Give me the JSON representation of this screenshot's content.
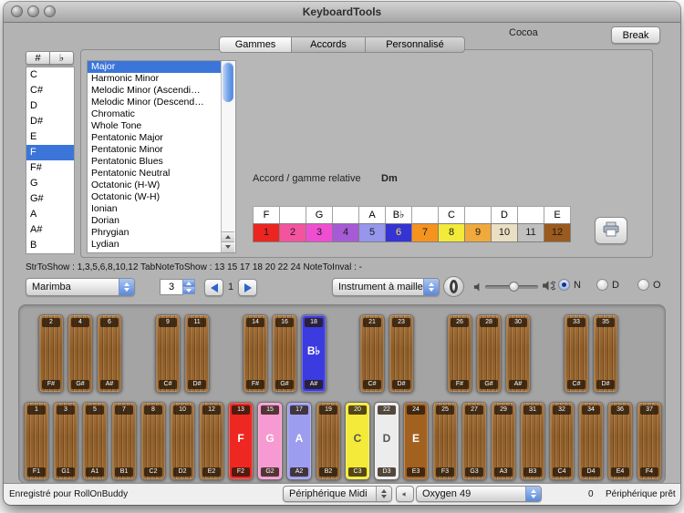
{
  "window": {
    "title": "KeyboardTools"
  },
  "header": {
    "cocoa": "Cocoa",
    "break": "Break"
  },
  "tabs": [
    {
      "label": "Gammes",
      "active": true
    },
    {
      "label": "Accords",
      "active": false
    },
    {
      "label": "Personnalisé",
      "active": false
    }
  ],
  "note_selector": {
    "sharp": "#",
    "flat": "♭",
    "notes": [
      "C",
      "C#",
      "D",
      "D#",
      "E",
      "F",
      "F#",
      "G",
      "G#",
      "A",
      "A#",
      "B"
    ],
    "selected_index": 5
  },
  "scales": {
    "items": [
      "Major",
      "Harmonic Minor",
      "Melodic Minor (Ascendi…",
      "Melodic Minor (Descend…",
      "Chromatic",
      "Whole Tone",
      "Pentatonic Major",
      "Pentatonic Minor",
      "Pentatonic Blues",
      "Pentatonic Neutral",
      "Octatonic (H-W)",
      "Octatonic (W-H)",
      "Ionian",
      "Dorian",
      "Phrygian",
      "Lydian"
    ],
    "selected_index": 0
  },
  "relative": {
    "label": "Accord / gamme relative",
    "value": "Dm"
  },
  "scale_cells": {
    "letters": [
      "F",
      "",
      "G",
      "",
      "A",
      "B♭",
      "",
      "C",
      "",
      "D",
      "",
      "E"
    ],
    "cells": [
      {
        "num": "1",
        "color": "#ec2520",
        "text": "#1a1a1a"
      },
      {
        "num": "2",
        "color": "#f4549e",
        "text": "#1a1a1a"
      },
      {
        "num": "3",
        "color": "#f04ed2",
        "text": "#1a1a1a"
      },
      {
        "num": "4",
        "color": "#a75ad6",
        "text": "#1a1a1a"
      },
      {
        "num": "5",
        "color": "#9696ec",
        "text": "#1a1a1a"
      },
      {
        "num": "6",
        "color": "#3434d4",
        "text": "#ffe04a"
      },
      {
        "num": "7",
        "color": "#f5931f",
        "text": "#1a1a1a"
      },
      {
        "num": "8",
        "color": "#f3ea39",
        "text": "#1a1a1a"
      },
      {
        "num": "9",
        "color": "#efa93c",
        "text": "#1a1a1a"
      },
      {
        "num": "10",
        "color": "#eadfc4",
        "text": "#1a1a1a"
      },
      {
        "num": "11",
        "color": "#c0c0c0",
        "text": "#1a1a1a"
      },
      {
        "num": "12",
        "color": "#9b5a1e",
        "text": "#1a1a1a"
      }
    ]
  },
  "status_line": "StrToShow : 1,3,5,6,8,10,12 TabNoteToShow : 13 15 17 18 20 22 24  NoteToInval : -",
  "controls": {
    "instrument_popup": "Marimba",
    "octave_value": "3",
    "page_value": "1",
    "mallet_popup": "Instrument à maillet",
    "radios": [
      {
        "label": "N",
        "selected": true
      },
      {
        "label": "D",
        "selected": false
      },
      {
        "label": "O",
        "selected": false
      }
    ]
  },
  "keyboard": {
    "top_bars": [
      {
        "num": "2",
        "note": "F#"
      },
      {
        "num": "4",
        "note": "G#"
      },
      {
        "num": "6",
        "note": "A#"
      },
      {
        "num": "9",
        "note": "C#"
      },
      {
        "num": "11",
        "note": "D#"
      },
      {
        "num": "14",
        "note": "F#"
      },
      {
        "num": "16",
        "note": "G#"
      },
      {
        "num": "18",
        "note": "A#",
        "display": "B♭",
        "color": "#3b3be0",
        "text_color": "#ffffff"
      },
      {
        "num": "21",
        "note": "C#"
      },
      {
        "num": "23",
        "note": "D#"
      },
      {
        "num": "26",
        "note": "F#"
      },
      {
        "num": "28",
        "note": "G#"
      },
      {
        "num": "30",
        "note": "A#"
      },
      {
        "num": "33",
        "note": "C#"
      },
      {
        "num": "35",
        "note": "D#"
      }
    ],
    "bottom_bars": [
      {
        "num": "1",
        "note": "F1"
      },
      {
        "num": "3",
        "note": "G1"
      },
      {
        "num": "5",
        "note": "A1"
      },
      {
        "num": "7",
        "note": "B1"
      },
      {
        "num": "8",
        "note": "C2"
      },
      {
        "num": "10",
        "note": "D2"
      },
      {
        "num": "12",
        "note": "E2"
      },
      {
        "num": "13",
        "note": "F2",
        "display": "F",
        "color": "#ee2722",
        "text_color": "#ffffff"
      },
      {
        "num": "15",
        "note": "G2",
        "display": "G",
        "color": "#f79ad2",
        "text_color": "#ffffff"
      },
      {
        "num": "17",
        "note": "A2",
        "display": "A",
        "color": "#9d9df0",
        "text_color": "#ffffff"
      },
      {
        "num": "19",
        "note": "B2"
      },
      {
        "num": "20",
        "note": "C3",
        "display": "C",
        "color": "#f3ea39",
        "text_color": "#555555"
      },
      {
        "num": "22",
        "note": "D3",
        "display": "D",
        "color": "#ececec",
        "text_color": "#555555"
      },
      {
        "num": "24",
        "note": "E3",
        "display": "E",
        "color": "#a3611f",
        "text_color": "#ffffff"
      },
      {
        "num": "25",
        "note": "F3"
      },
      {
        "num": "27",
        "note": "G3"
      },
      {
        "num": "29",
        "note": "A3"
      },
      {
        "num": "31",
        "note": "B3"
      },
      {
        "num": "32",
        "note": "C4"
      },
      {
        "num": "34",
        "note": "D4"
      },
      {
        "num": "36",
        "note": "E4"
      },
      {
        "num": "37",
        "note": "F4"
      }
    ]
  },
  "footer": {
    "registered": "Enregistré pour RollOnBuddy",
    "midi_popup": "Périphérique Midi",
    "device_popup": "Oxygen 49",
    "count": "0",
    "status": "Périphérique prêt"
  },
  "colors": {
    "selection": "#3b75d9",
    "highlight_blue": "#3b3be0"
  }
}
